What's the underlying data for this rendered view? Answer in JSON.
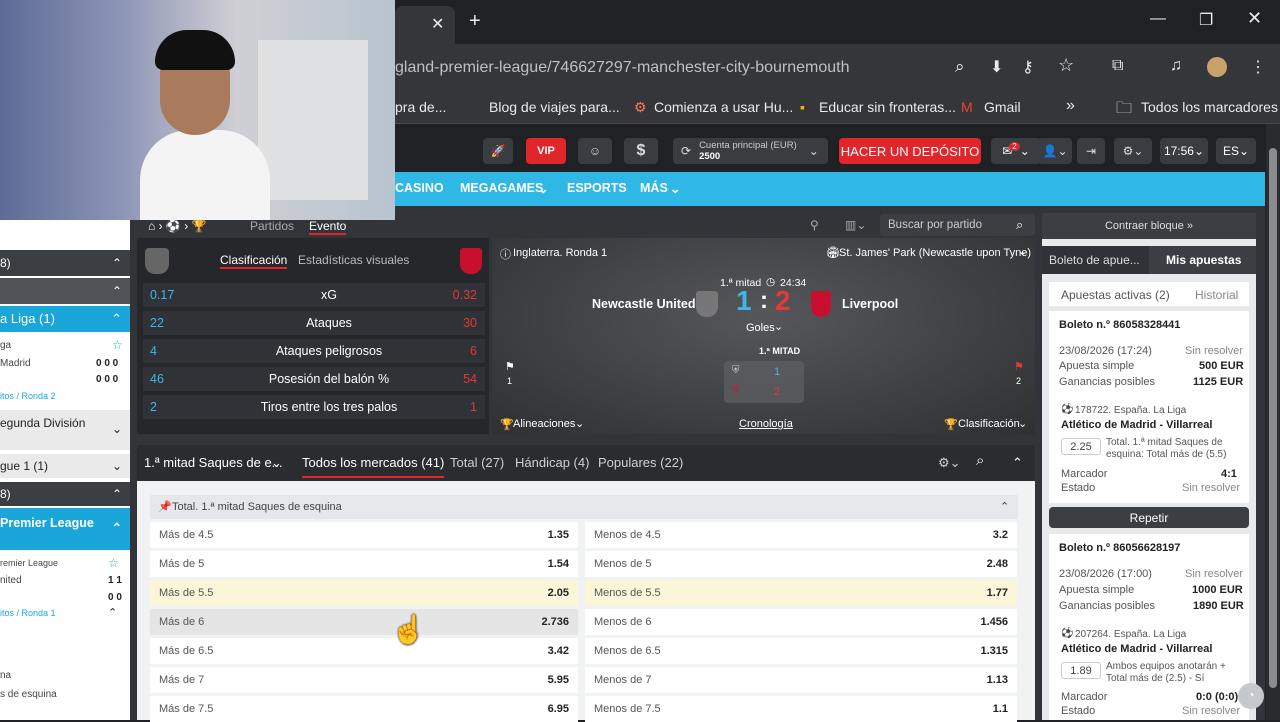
{
  "browser": {
    "url": "gland-premier-league/746627297-manchester-city-bournemouth",
    "bookmarks": [
      "pra de...",
      "Blog de viajes para...",
      "Comienza a usar Hu...",
      "Educar sin fronteras...",
      "Gmail"
    ],
    "all_bookmarks": "Todos los marcadores"
  },
  "header": {
    "vip": "VIP",
    "account_label": "Cuenta principal (EUR)",
    "balance": "2500",
    "deposit": "HACER UN DEPÓSITO",
    "mail_count": "2",
    "time": "17:56",
    "lang": "ES"
  },
  "nav": [
    "CASINO",
    "MEGAGAMES",
    "ESPORTS",
    "MÁS"
  ],
  "left": {
    "rows": [
      {
        "t": "8)",
        "style": "dark"
      },
      {
        "t": "",
        "style": "dark"
      },
      {
        "t": "a Liga (1)",
        "style": "blue"
      },
      {
        "t": "ga",
        "style": "white"
      },
      {
        "t": "Madrid",
        "s": "0 0 0",
        "style": "white"
      },
      {
        "t": "",
        "s": "0 0 0",
        "style": "white"
      },
      {
        "t": "itos / Ronda 2",
        "style": "link"
      },
      {
        "t": "egunda División",
        "style": "white"
      },
      {
        "t": "gue 1 (1)",
        "style": "white"
      },
      {
        "t": "8)",
        "style": "dark"
      },
      {
        "t": "Premier League",
        "style": "blue"
      },
      {
        "t": "remier League",
        "style": "white"
      },
      {
        "t": "nited",
        "s": "1 1",
        "style": "white"
      },
      {
        "t": "",
        "s": "0 0",
        "style": "white"
      },
      {
        "t": "itos / Ronda 1",
        "style": "link"
      },
      {
        "t": "na",
        "style": "white"
      },
      {
        "t": "s de esquina",
        "style": "white"
      }
    ]
  },
  "breadcrumb": {
    "partidos": "Partidos",
    "evento": "Evento",
    "search_placeholder": "Buscar por partido"
  },
  "stats": {
    "tab1": "Clasificación",
    "tab2": "Estadísticas visuales",
    "rows": [
      {
        "l": "0.17",
        "m": "xG",
        "r": "0.32"
      },
      {
        "l": "22",
        "m": "Ataques",
        "r": "30"
      },
      {
        "l": "4",
        "m": "Ataques peligrosos",
        "r": "6"
      },
      {
        "l": "46",
        "m": "Posesión del balón %",
        "r": "54"
      },
      {
        "l": "2",
        "m": "Tiros entre los tres palos",
        "r": "1"
      }
    ]
  },
  "match": {
    "league": "Inglaterra. Ronda 1",
    "venue": "St. James' Park (Newcastle upon Tyne)",
    "period": "1.ª mitad",
    "clock": "24:34",
    "home": "Newcastle United",
    "away": "Liverpool",
    "home_score": "1",
    "away_score": "2",
    "goles": "Goles",
    "half": "1.ª MITAD",
    "home_half": "1",
    "away_half": "2",
    "hf": "1",
    "af": "2",
    "alineaciones": "Alineaciones",
    "cronologia": "Cronología",
    "clasificacion": "Clasificación"
  },
  "markets": {
    "sel": "1.ª mitad Saques de e...",
    "tabs": [
      "Todos los mercados (41)",
      "Total (27)",
      "Hándicap (4)",
      "Populares (22)"
    ],
    "group": "Total. 1.ª mitad Saques de esquina",
    "rows": [
      {
        "a": "Más de 4.5",
        "ao": "1.35",
        "b": "Menos de 4.5",
        "bo": "3.2"
      },
      {
        "a": "Más de 5",
        "ao": "1.54",
        "b": "Menos de 5",
        "bo": "2.48"
      },
      {
        "a": "Más de 5.5",
        "ao": "2.05",
        "b": "Menos de 5.5",
        "bo": "1.77"
      },
      {
        "a": "Más de 6",
        "ao": "2.736",
        "b": "Menos de 6",
        "bo": "1.456"
      },
      {
        "a": "Más de 6.5",
        "ao": "3.42",
        "b": "Menos de 6.5",
        "bo": "1.315"
      },
      {
        "a": "Más de 7",
        "ao": "5.95",
        "b": "Menos de 7",
        "bo": "1.13"
      },
      {
        "a": "Más de 7.5",
        "ao": "6.95",
        "b": "Menos de 7.5",
        "bo": "1.1"
      }
    ]
  },
  "betslip": {
    "collapse": "Contraer bloque",
    "tab1": "Boleto de apue...",
    "tab2": "Mis apuestas",
    "active": "Apuestas activas (2)",
    "history": "Historial",
    "bets": [
      {
        "id": "Boleto n.º 86058328441",
        "date": "23/08/2026 (17:24)",
        "status": "Sin resolver",
        "type": "Apuesta simple",
        "stake": "500 EUR",
        "gan": "Ganancias posibles",
        "payout": "1125 EUR",
        "ev": "178722. España. La Liga",
        "match": "Atlético de Madrid - Villarreal",
        "odd": "2.25",
        "desc": "Total. 1.ª mitad Saques de esquina: Total más de (5.5)",
        "marc": "Marcador",
        "score": "4:1",
        "estado": "Estado",
        "est": "Sin resolver"
      },
      {
        "id": "Boleto n.º 86056628197",
        "date": "23/08/2026 (17:00)",
        "status": "Sin resolver",
        "type": "Apuesta simple",
        "stake": "1000 EUR",
        "gan": "Ganancias posibles",
        "payout": "1890 EUR",
        "ev": "207264. España. La Liga",
        "match": "Atlético de Madrid - Villarreal",
        "odd": "1.89",
        "desc": "Ambos equipos anotarán + Total más de (2.5) - Sí",
        "marc": "Marcador",
        "score": "0:0 (0:0)",
        "estado": "Estado",
        "est": "Sin resolver"
      }
    ],
    "repeat": "Repetir"
  }
}
